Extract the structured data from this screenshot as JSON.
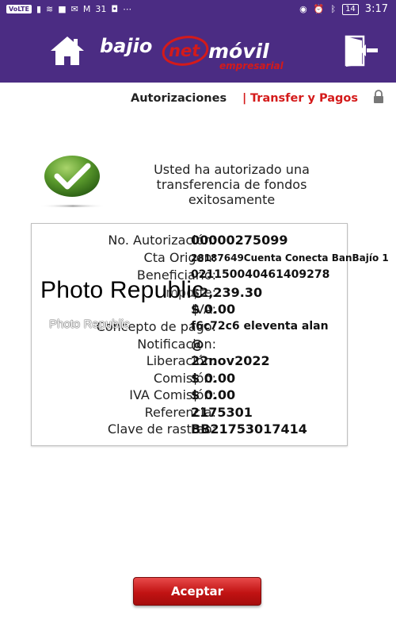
{
  "status_bar": {
    "network": "VoLTE",
    "time": "3:17",
    "battery": "14",
    "calendar": "31"
  },
  "header": {
    "logo_bajio": "bajio",
    "logo_net": "net",
    "logo_movil": "móvil",
    "logo_empresarial": "empresarial",
    "brand_color": "#4b2c83",
    "accent_color": "#d41a1a"
  },
  "breadcrumb": {
    "current": "Autorizaciones",
    "separator": "|",
    "section": "Transfer y Pagos"
  },
  "message": "Usted ha autorizado una transferencia de fondos exitosamente",
  "details": [
    {
      "label": "No. Autorización:",
      "value": "00000275099"
    },
    {
      "label": "Cta Origen:",
      "value": "28187649Cuenta Conecta BanBajío 1"
    },
    {
      "label": "Beneficiario:",
      "value": "021150040461409278"
    },
    {
      "label": "Importe:",
      "value": "$2,239.30"
    },
    {
      "label": "IVA:",
      "value": "$ 0.00"
    },
    {
      "label": "Concepto de pago:",
      "value": "f6c72c6 eleventa alan"
    },
    {
      "label": "Notificacion:",
      "value": "@"
    },
    {
      "label": "Liberación:",
      "value": "22nov2022"
    },
    {
      "label": "Comisión:",
      "value": "$ 0.00"
    },
    {
      "label": "IVA Comisión:",
      "value": "$ 0.00"
    },
    {
      "label": "Referencia:",
      "value": "2175301"
    },
    {
      "label": "Clave de rastreo:",
      "value": "BB21753017414"
    }
  ],
  "watermark": "Photo Republic",
  "watermark2": "Photo Republic",
  "accept_button": "Aceptar"
}
